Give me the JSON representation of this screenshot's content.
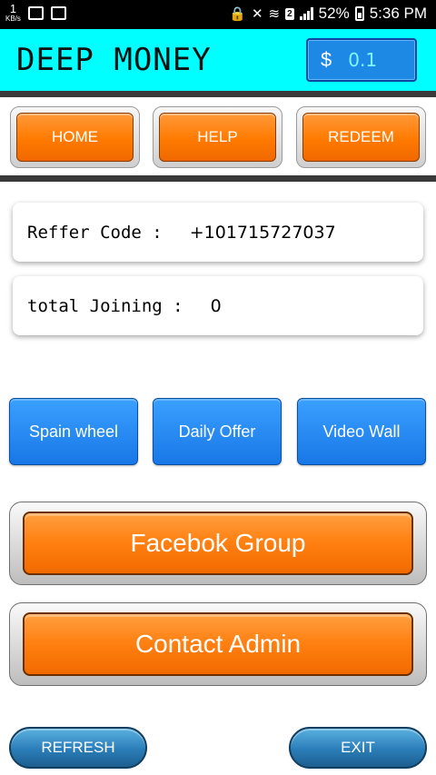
{
  "status_bar": {
    "speed": "1",
    "speed_unit": "KB/s",
    "sim_slot": "2",
    "battery": "52%",
    "time": "5:36 PM"
  },
  "header": {
    "title": "DEEP MONEY",
    "currency_symbol": "$",
    "balance": "0.1"
  },
  "nav": {
    "home": "HOME",
    "help": "HELP",
    "redeem": "REDEEM"
  },
  "info": {
    "refer_label": "Reffer Code :",
    "refer_value": "+101715727037",
    "joining_label": "total Joining :",
    "joining_value": "0"
  },
  "actions": {
    "spin": "Spain wheel",
    "daily": "Daily Offer",
    "video": "Video Wall"
  },
  "links": {
    "facebook": "Facebok Group",
    "contact": "Contact Admin"
  },
  "footer": {
    "refresh": "REFRESH",
    "exit": "EXIT"
  },
  "colors": {
    "header_bg": "#00ffff",
    "orange": "#ff7f10",
    "blue": "#1e88e5",
    "dark_band": "#3a3a3a"
  }
}
